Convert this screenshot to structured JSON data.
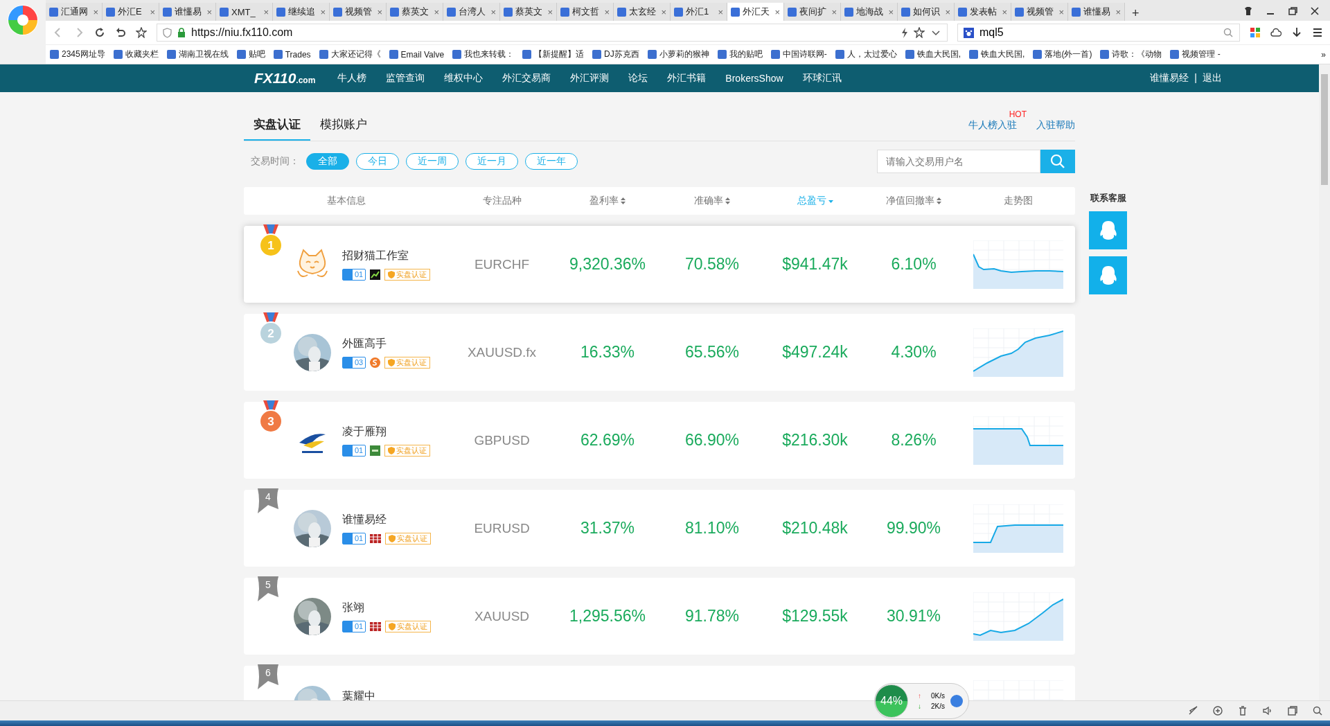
{
  "browser": {
    "tabs": [
      {
        "title": "汇通网",
        "selected": false
      },
      {
        "title": "外汇E",
        "selected": false
      },
      {
        "title": "谁懂易",
        "selected": false
      },
      {
        "title": "XMT_",
        "selected": false
      },
      {
        "title": "继续追",
        "selected": false
      },
      {
        "title": "视频管",
        "selected": false
      },
      {
        "title": "蔡英文",
        "selected": false
      },
      {
        "title": "台湾人",
        "selected": false
      },
      {
        "title": "蔡英文",
        "selected": false
      },
      {
        "title": "柯文哲",
        "selected": false
      },
      {
        "title": "太玄经",
        "selected": false
      },
      {
        "title": "外汇1",
        "selected": false
      },
      {
        "title": "外汇天",
        "selected": true
      },
      {
        "title": "夜间扩",
        "selected": false
      },
      {
        "title": "地海战",
        "selected": false
      },
      {
        "title": "如何识",
        "selected": false
      },
      {
        "title": "发表帖",
        "selected": false
      },
      {
        "title": "视频管",
        "selected": false
      },
      {
        "title": "谁懂易",
        "selected": false
      }
    ],
    "new_tab": "+",
    "close": "×",
    "url": "https://niu.fx110.com",
    "search_value": "mql5",
    "bookmarks": [
      "2345网址导",
      "收藏夹栏",
      "湖南卫视在线",
      "贴吧",
      "Trades",
      "大家还记得《",
      "Email Valve",
      "我也来转载：",
      "【新提醒】适",
      "DJ苏克西",
      "小萝莉的猴神",
      "我的贴吧",
      "中国诗联网-",
      "人，太过爱心",
      "铁血大民国,",
      "铁血大民国,",
      "落地(外一首)",
      "诗歌：《动物",
      "视频管理 -"
    ],
    "bookmarks_more": "»"
  },
  "site_nav": {
    "logo": "FX110",
    "logo_suffix": ".com",
    "items": [
      "牛人榜",
      "监管查询",
      "维权中心",
      "外汇交易商",
      "外汇评测",
      "论坛",
      "外汇书籍",
      "BrokersShow",
      "环球汇讯"
    ],
    "user": "谁懂易经",
    "separator": "|",
    "logout": "退出"
  },
  "tabs": [
    {
      "label": "实盘认证",
      "selected": true
    },
    {
      "label": "模拟账户",
      "selected": false
    }
  ],
  "links": [
    {
      "label": "牛人榜入驻",
      "badge": "HOT"
    },
    {
      "label": "入驻帮助"
    }
  ],
  "filter": {
    "label": "交易时间：",
    "options": [
      {
        "label": "全部",
        "selected": true
      },
      {
        "label": "今日",
        "selected": false
      },
      {
        "label": "近一周",
        "selected": false
      },
      {
        "label": "近一月",
        "selected": false
      },
      {
        "label": "近一年",
        "selected": false
      }
    ]
  },
  "search": {
    "placeholder": "请输入交易用户名"
  },
  "table": {
    "columns": [
      {
        "label": "基本信息",
        "sortable": false,
        "selected": false
      },
      {
        "label": "专注品种",
        "sortable": false,
        "selected": false
      },
      {
        "label": "盈利率",
        "sortable": true,
        "selected": false
      },
      {
        "label": "准确率",
        "sortable": true,
        "selected": false
      },
      {
        "label": "总盈亏",
        "sortable": true,
        "selected": true
      },
      {
        "label": "净值回撤率",
        "sortable": true,
        "selected": false
      },
      {
        "label": "走势图",
        "sortable": false,
        "selected": false
      }
    ],
    "rows": [
      {
        "medal": {
          "kind": "gold",
          "rank": "1"
        },
        "avatar": {
          "kind": "cat"
        },
        "name": "招财猫工作室",
        "followers": "01",
        "platform": {
          "kind": "chart"
        },
        "verified": "实盘认证",
        "symbol": "EURCHF",
        "profit_rate": "9,320.36%",
        "accuracy": "70.58%",
        "total_pl": "$941.47k",
        "drawdown": "6.10%",
        "highlighted": true
      },
      {
        "medal": {
          "kind": "silver",
          "rank": "2"
        },
        "name": "外匯高手",
        "followers": "03",
        "platform": {
          "kind": "coin"
        },
        "verified": "实盘认证",
        "symbol": "XAUUSD.fx",
        "profit_rate": "16.33%",
        "accuracy": "65.56%",
        "total_pl": "$497.24k",
        "drawdown": "4.30%",
        "highlighted": false
      },
      {
        "medal": {
          "kind": "bronze",
          "rank": "3"
        },
        "avatar": {
          "kind": "logo"
        },
        "name": "凌于雁翔",
        "followers": "01",
        "platform": {
          "kind": "square"
        },
        "verified": "实盘认证",
        "symbol": "GBPUSD",
        "profit_rate": "62.69%",
        "accuracy": "66.90%",
        "total_pl": "$216.30k",
        "drawdown": "8.26%",
        "highlighted": false
      },
      {
        "medal": {
          "kind": "ribbon",
          "rank": "4"
        },
        "name": "谁懂易经",
        "followers": "01",
        "platform": {
          "kind": "flag"
        },
        "verified": "实盘认证",
        "symbol": "EURUSD",
        "profit_rate": "31.37%",
        "accuracy": "81.10%",
        "total_pl": "$210.48k",
        "drawdown": "99.90%",
        "highlighted": false
      },
      {
        "medal": {
          "kind": "ribbon",
          "rank": "5"
        },
        "name": "张翊",
        "followers": "01",
        "platform": {
          "kind": "flag"
        },
        "verified": "实盘认证",
        "symbol": "XAUUSD",
        "profit_rate": "1,295.56%",
        "accuracy": "91.78%",
        "total_pl": "$129.55k",
        "drawdown": "30.91%",
        "highlighted": false
      },
      {
        "medal": {
          "kind": "ribbon",
          "rank": "6"
        },
        "name": "葉耀中",
        "highlighted": false
      }
    ]
  },
  "side": {
    "title": "联系客服"
  },
  "net_widget": {
    "percent": "44%",
    "up_arrow": "↑",
    "up": "0K/s",
    "down_arrow": "↓",
    "down": "2K/s"
  }
}
